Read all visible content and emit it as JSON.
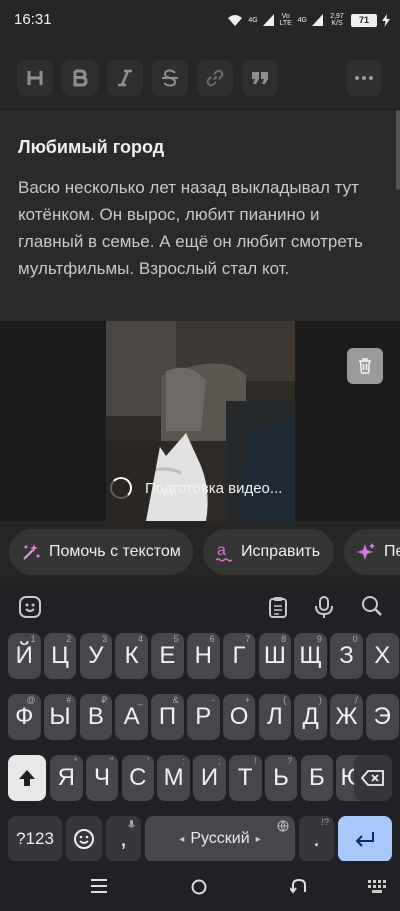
{
  "status_bar": {
    "time": "16:31",
    "net1": "4G",
    "volte": "Vo LTE",
    "net2": "4G",
    "speed": "2,97 K/S",
    "battery": "71"
  },
  "toolbar": {
    "buttons": [
      "heading-icon",
      "bold-icon",
      "italic-icon",
      "strikethrough-icon",
      "link-icon",
      "quote-icon",
      "more-icon"
    ]
  },
  "article": {
    "title": "Любимый город",
    "body": "Васю несколько лет назад выкладывал тут котёнком. Он вырос, любит пианино и главный в семье. А ещё он любит смотреть мультфильмы. Взрослый стал кот."
  },
  "video": {
    "status": "Подготовка видео..."
  },
  "ai_chips": {
    "help": "Помочь с текстом",
    "fix": "Исправить",
    "third": "Пе"
  },
  "keyboard": {
    "row1": [
      "Й",
      "Ц",
      "У",
      "К",
      "Е",
      "Н",
      "Г",
      "Ш",
      "Щ",
      "З",
      "Х"
    ],
    "row1_hints": [
      "1",
      "2",
      "3",
      "4",
      "5",
      "6",
      "7",
      "8",
      "9",
      "0",
      ""
    ],
    "row2": [
      "Ф",
      "Ы",
      "В",
      "А",
      "П",
      "Р",
      "О",
      "Л",
      "Д",
      "Ж",
      "Э"
    ],
    "row2_hints": [
      "@",
      "#",
      "₽",
      "_",
      "&",
      "-",
      "+",
      "(",
      ")",
      "/",
      ""
    ],
    "row3": [
      "Я",
      "Ч",
      "С",
      "М",
      "И",
      "Т",
      "Ь",
      "Б",
      "Ю"
    ],
    "row3_hints": [
      "*",
      "\"",
      "'",
      ":",
      ";",
      "!",
      "?",
      "",
      ""
    ],
    "symbols": "?123",
    "comma": ",",
    "space": "Русский",
    "period": ".",
    "period_hint": "!?"
  },
  "colors": {
    "background": "#202020",
    "article_bg": "#2a2a2a",
    "key": "#46474b",
    "enter_key": "#a8c7fa"
  }
}
